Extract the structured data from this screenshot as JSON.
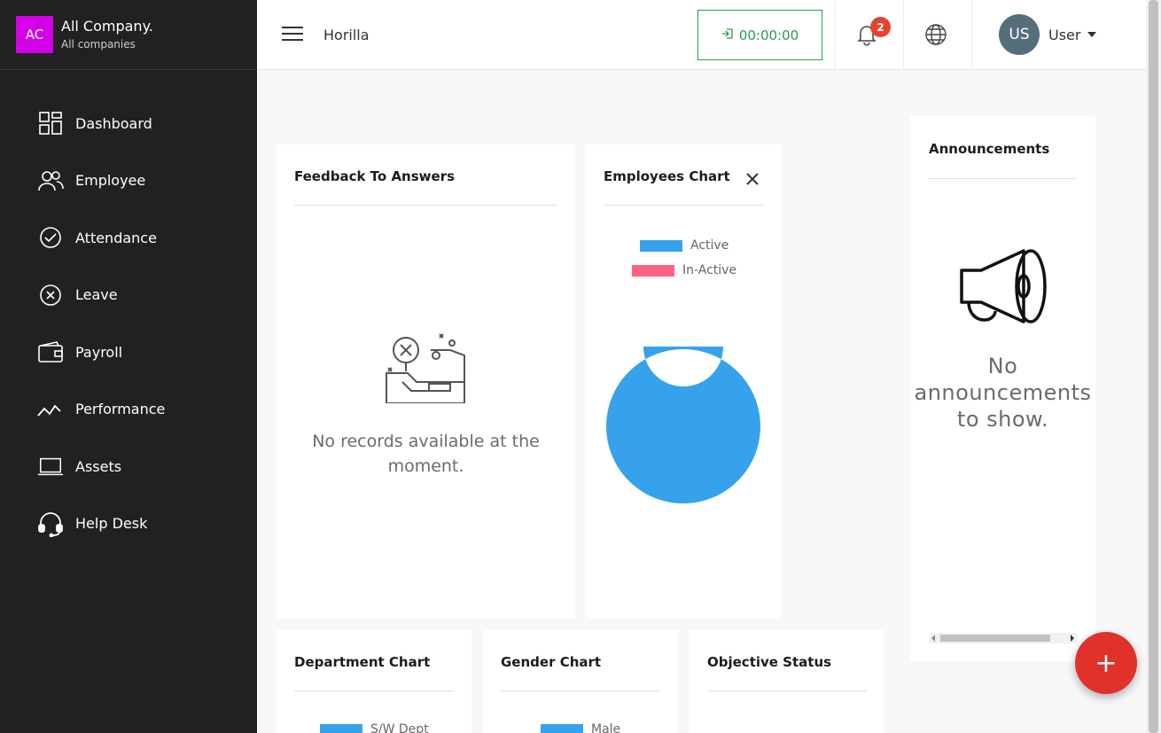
{
  "company": {
    "avatar": "AC",
    "name": "All Company.",
    "subtitle": "All companies"
  },
  "sidebar": {
    "items": [
      {
        "label": "Dashboard",
        "icon": "dashboard-icon"
      },
      {
        "label": "Employee",
        "icon": "employee-icon"
      },
      {
        "label": "Attendance",
        "icon": "attendance-icon"
      },
      {
        "label": "Leave",
        "icon": "leave-icon"
      },
      {
        "label": "Payroll",
        "icon": "payroll-icon"
      },
      {
        "label": "Performance",
        "icon": "performance-icon"
      },
      {
        "label": "Assets",
        "icon": "assets-icon"
      },
      {
        "label": "Help Desk",
        "icon": "help-desk-icon"
      }
    ]
  },
  "header": {
    "brand": "Horilla",
    "timer": "00:00:00",
    "notification_count": "2",
    "user_initials": "US",
    "user_name": "User"
  },
  "cards": {
    "feedback": {
      "title": "Feedback To Answers",
      "empty_message": "No records available at the moment."
    },
    "employees_chart": {
      "title": "Employees Chart"
    },
    "announcements": {
      "title": "Announcements",
      "empty_message": "No announcements to show."
    },
    "department_chart": {
      "title": "Department Chart",
      "legend": "S/W Dept"
    },
    "gender_chart": {
      "title": "Gender Chart",
      "legend": "Male"
    },
    "objective_status": {
      "title": "Objective Status"
    }
  },
  "chart_data": {
    "type": "pie",
    "title": "Employees Chart",
    "categories": [
      "Active",
      "In-Active"
    ],
    "values": [
      100,
      0
    ],
    "colors": [
      "#36a2eb",
      "#ff6384"
    ],
    "legend": "top"
  },
  "fab": {
    "label": "+"
  },
  "colors": {
    "sidebar": "#212121",
    "accent_green": "#24a148",
    "badge": "#e5432d",
    "fab": "#e0312b",
    "company_avatar": "#d400e8"
  }
}
